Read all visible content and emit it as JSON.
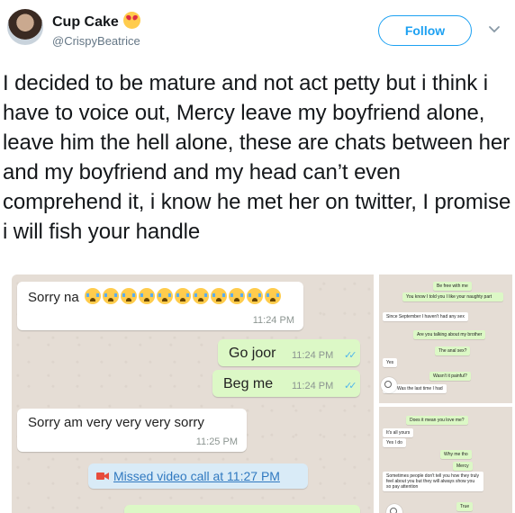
{
  "author": {
    "name": "Cup Cake",
    "handle": "@CrispyBeatrice",
    "follow_label": "Follow"
  },
  "tweet": {
    "text": "I decided to be mature and not act petty but i think i have to voice out, Mercy leave my boyfriend alone, leave him the hell alone, these are chats between her and my boyfriend and my head can’t even comprehend it, i know he met her on twitter, I promise i will fish your handle"
  },
  "chat_main": {
    "msg1": {
      "text": "Sorry na",
      "time": "11:24 PM",
      "emoji": "crying-face"
    },
    "msg2": {
      "text": "Go joor",
      "time": "11:24 PM"
    },
    "msg3": {
      "text": "Beg me",
      "time": "11:24 PM"
    },
    "msg4": {
      "text": "Sorry am very very very sorry",
      "time": "11:25 PM"
    },
    "missed_call": {
      "text": "Missed video call at 11:27 PM"
    }
  },
  "chat_thumb1": {
    "m1": "Be free with me",
    "m2": "You know I told you I like your naughty part",
    "m3": "Since September I haven't had any sex",
    "m4": "Are you talking about my brother",
    "m5": "The anal sex?",
    "m6": "Yes",
    "m7": "Wasn't it painful?",
    "m8": "Was the last time I had"
  },
  "chat_thumb2": {
    "m1": "Does it mean you love me?",
    "m2": "It's all yours",
    "m3": "Yes I do",
    "m4": "Why me tho",
    "m5": "Mercy",
    "m6": "Sometimes people don't tell you how they truly feel about you but they will always show you so pay attention",
    "m7": "True"
  },
  "colors": {
    "accent": "#1da1f2",
    "bubble_in": "#ffffff",
    "bubble_out": "#dcf8c6",
    "chat_bg": "#e5ddd5",
    "link": "#3079c0"
  }
}
